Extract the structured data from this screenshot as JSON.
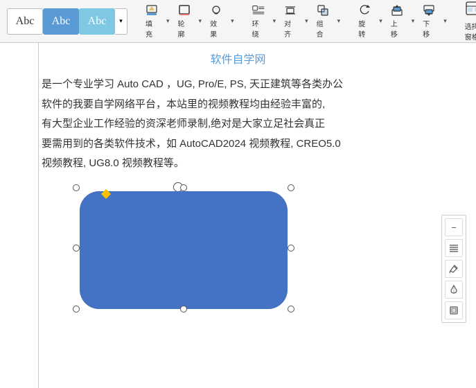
{
  "toolbar": {
    "style_buttons": [
      {
        "label": "Abc",
        "state": "normal"
      },
      {
        "label": "Abc",
        "state": "active"
      },
      {
        "label": "Abc",
        "state": "active2"
      }
    ],
    "fill_label": "填充",
    "outline_label": "轮廓",
    "effect_label": "效果",
    "wrap_label": "环绕",
    "align_label": "对齐",
    "combine_label": "组合",
    "rotate_label": "旋转",
    "up_label": "上移",
    "down_label": "下移",
    "select_window_label": "选择窗格",
    "dropdown_arrow": "▾"
  },
  "document": {
    "title": "软件自学网",
    "body": "是一个专业学习 Auto CAD，UG, Pro/E, PS, 天正建筑等各类办公软件的我要自学网络平台，本站里的视频教程均由经验丰富的,有大型企业工作经验的资深老师录制,绝对是大家立足社会真正要需用到的各类软件技术，如 AutoCAD2024 视频教程, CREO5.0 视频教程, UG8.0 视频教程等。"
  },
  "floating_toolbar": {
    "buttons": [
      {
        "icon": "−",
        "name": "minus-btn"
      },
      {
        "icon": "≡",
        "name": "align-btn"
      },
      {
        "icon": "✏",
        "name": "edit-btn"
      },
      {
        "icon": "◈",
        "name": "fill-btn"
      },
      {
        "icon": "▣",
        "name": "outline-btn"
      }
    ]
  }
}
